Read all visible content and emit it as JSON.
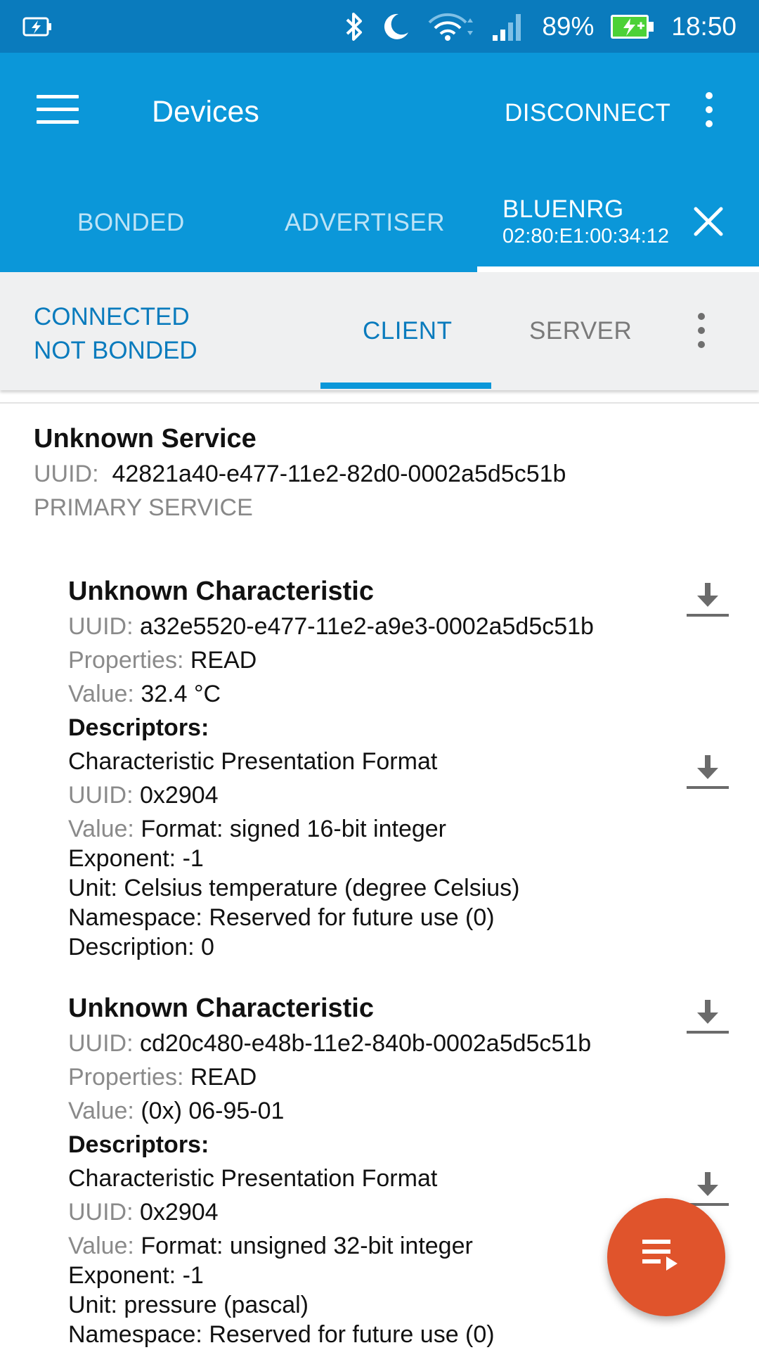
{
  "status_bar": {
    "battery_percent": "89%",
    "time": "18:50",
    "icons": [
      "battery-charging-icon",
      "bluetooth-icon",
      "moon-icon",
      "wifi-icon",
      "signal-icon",
      "battery-icon"
    ]
  },
  "app_bar": {
    "title": "Devices",
    "disconnect_label": "DISCONNECT",
    "tabs": [
      {
        "label": "BONDED"
      },
      {
        "label": "ADVERTISER"
      },
      {
        "label": "BLUENRG",
        "address": "02:80:E1:00:34:12",
        "selected": true
      }
    ]
  },
  "connection": {
    "state": "CONNECTED",
    "bond_state": "NOT BONDED",
    "tabs": [
      {
        "label": "CLIENT",
        "selected": true
      },
      {
        "label": "SERVER"
      }
    ]
  },
  "service": {
    "name": "Unknown Service",
    "uuid_label": "UUID:",
    "uuid": "42821a40-e477-11e2-82d0-0002a5d5c51b",
    "type": "PRIMARY SERVICE"
  },
  "characteristics": [
    {
      "name": "Unknown Characteristic",
      "uuid_label": "UUID:",
      "uuid": "a32e5520-e477-11e2-a9e3-0002a5d5c51b",
      "properties_label": "Properties:",
      "properties": "READ",
      "value_label": "Value:",
      "value": "32.4 °C",
      "descriptors_label": "Descriptors:",
      "descriptor": {
        "name": "Characteristic Presentation Format",
        "uuid_label": "UUID:",
        "uuid": "0x2904",
        "value_label": "Value:",
        "format": "Format: signed 16-bit integer",
        "exponent": "Exponent: -1",
        "unit": "Unit: Celsius temperature (degree Celsius)",
        "namespace": "Namespace: Reserved for future use (0)",
        "description": "Description: 0"
      }
    },
    {
      "name": "Unknown Characteristic",
      "uuid_label": "UUID:",
      "uuid": "cd20c480-e48b-11e2-840b-0002a5d5c51b",
      "properties_label": "Properties:",
      "properties": "READ",
      "value_label": "Value:",
      "value": "(0x) 06-95-01",
      "descriptors_label": "Descriptors:",
      "descriptor": {
        "name": "Characteristic Presentation Format",
        "uuid_label": "UUID:",
        "uuid": "0x2904",
        "value_label": "Value:",
        "format": "Format: unsigned 32-bit integer",
        "exponent": "Exponent: -1",
        "unit": "Unit: pressure (pascal)",
        "namespace": "Namespace: Reserved for future use (0)"
      }
    }
  ],
  "colors": {
    "status_bar": "#0a7bbd",
    "app_bar": "#0b97d9",
    "accent": "#0a7bbd",
    "fab": "#e0542c"
  }
}
